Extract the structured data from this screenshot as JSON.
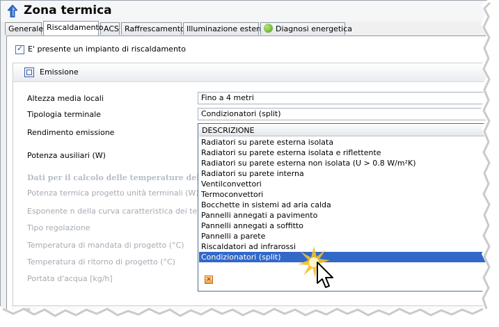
{
  "window": {
    "title": "Zona termica"
  },
  "tabs": [
    {
      "label": "Generale",
      "active": false
    },
    {
      "label": "Riscaldamento",
      "active": true
    },
    {
      "label": "ACS",
      "active": false
    },
    {
      "label": "Raffrescamento",
      "active": false
    },
    {
      "label": "Illuminazione esterna",
      "active": false
    },
    {
      "label": "Diagnosi energetica",
      "active": false
    }
  ],
  "heating": {
    "present_label": "E' presente un impianto di riscaldamento",
    "present_checked": true
  },
  "emission": {
    "title": "Emissione",
    "labels": {
      "height": "Altezza media locali",
      "terminal_type": "Tipologia terminale",
      "efficiency": "Rendimento emissione",
      "aux_power": "Potenza ausiliari (W)",
      "fluid_section": "Dati per il calcolo delle temperature del fluido",
      "terminal_power": "Potenza termica progetto unità terminali (W)",
      "curve_exponent": "Esponente n della curva caratteristica dei terminali",
      "regulation": "Tipo regolazione",
      "supply_temp": "Temperatura di mandata di progetto (°C)",
      "return_temp": "Temperatura di ritorno di progetto (°C)",
      "water_flow": "Portata d'acqua [kg/h]"
    },
    "values": {
      "height": "Fino a 4 metri",
      "terminal_type": "Condizionatori (split)"
    },
    "dropdown": {
      "header": "DESCRIZIONE",
      "options": [
        "Radiatori su parete esterna isolata",
        "Radiatori su parete esterna isolata e riflettente",
        "Radiatori su parete esterna non isolata (U > 0.8 W/m²K)",
        "Radiatori su parete interna",
        "Ventilconvettori",
        "Termoconvettori",
        "Bocchette in sistemi ad aria calda",
        "Pannelli annegati a pavimento",
        "Pannelli annegati a soffitto",
        "Pannelli a parete",
        "Riscaldatori ad infrarossi",
        "Condizionatori (split)"
      ],
      "selected": "Condizionatori (split)"
    }
  },
  "colors": {
    "selection": "#3268c8",
    "accent": "#2f6ccf"
  }
}
